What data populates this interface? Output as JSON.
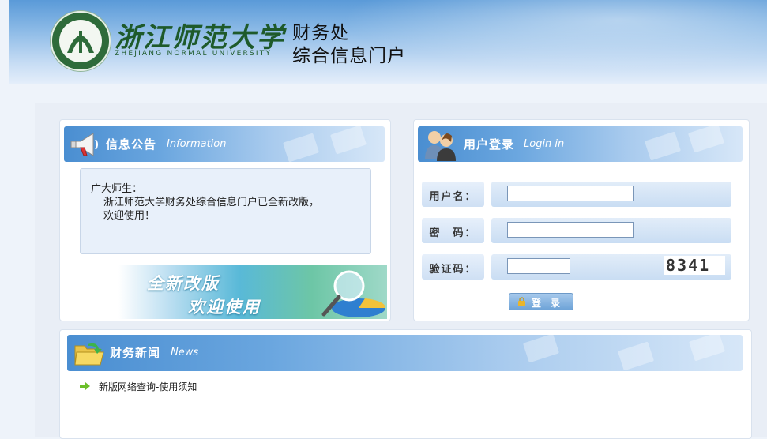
{
  "header": {
    "university_cn": "浙江师范大学",
    "university_en": "ZHEJIANG NORMAL UNIVERSITY",
    "department_line1": "财务处",
    "department_line2": "综合信息门户",
    "colors": {
      "header_blue": "#5a9ad8",
      "logo_green": "#1e5a2a"
    }
  },
  "info": {
    "title": "信息公告",
    "title_en": "Information",
    "greeting": "广大师生：",
    "message_line1": "浙江师范大学财务处综合信息门户已全新改版，",
    "message_line2": "欢迎使用！",
    "banner_line1": "全新改版",
    "banner_line2": "欢迎使用",
    "icon": "megaphone-icon"
  },
  "login": {
    "title": "用户登录",
    "title_en": "Login in",
    "username_label": "用户名：",
    "password_label": "密　码：",
    "captcha_label": "验证码：",
    "username_value": "",
    "password_value": "",
    "captcha_value": "",
    "captcha_text": "8341",
    "submit_label": "登 录",
    "icon": "users-icon"
  },
  "news": {
    "title": "财务新闻",
    "title_en": "News",
    "items": [
      {
        "label": "新版网络查询-使用须知"
      }
    ],
    "icon": "folder-icon"
  }
}
